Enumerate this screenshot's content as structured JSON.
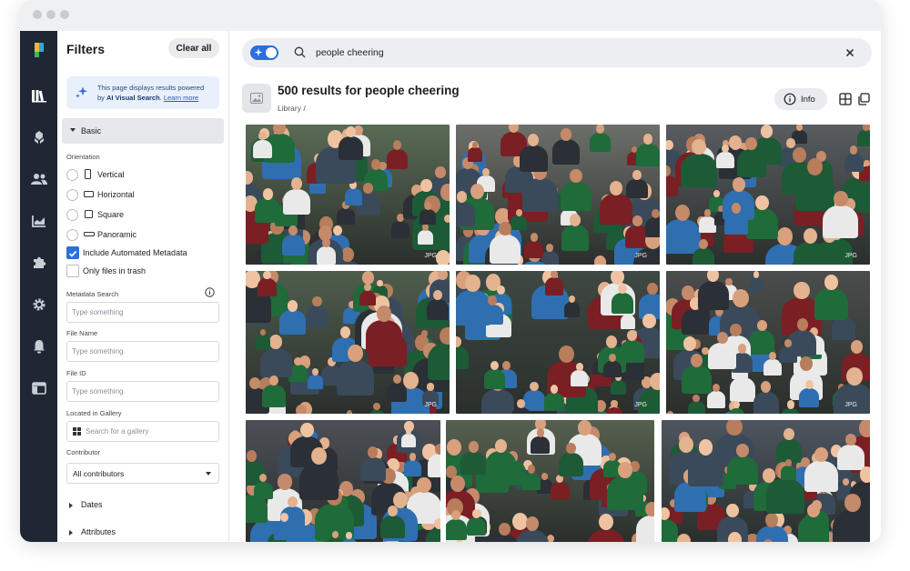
{
  "filters": {
    "title": "Filters",
    "clear_all": "Clear all",
    "ai_note": {
      "line1": "This page displays results powered",
      "by": "by ",
      "brand": "AI Visual Search",
      "learn_more": "Learn more"
    },
    "basic": "Basic",
    "orientation_label": "Orientation",
    "orientations": [
      "Vertical",
      "Horizontal",
      "Square",
      "Panoramic"
    ],
    "include_automated_metadata": "Include Automated Metadata",
    "include_automated_metadata_checked": true,
    "only_trash": "Only files in trash",
    "only_trash_checked": false,
    "metadata_search": {
      "label": "Metadata Search",
      "placeholder": "Type something"
    },
    "file_name": {
      "label": "File Name",
      "placeholder": "Type something"
    },
    "file_id": {
      "label": "File ID",
      "placeholder": "Type something"
    },
    "gallery": {
      "label": "Located in Gallery",
      "placeholder": "Search for a gallery"
    },
    "contributor": {
      "label": "Contributor",
      "value": "All contributors"
    },
    "dates": "Dates",
    "attributes": "Attributes"
  },
  "search": {
    "query": "people cheering"
  },
  "results": {
    "title": "500 results for people cheering",
    "breadcrumb": "Library /",
    "info_button": "Info"
  },
  "photos": [
    {
      "badge": "JPG",
      "tone": "#5a6b55"
    },
    {
      "badge": "JPG",
      "tone": "#6d6f6a"
    },
    {
      "badge": "JPG",
      "tone": "#595c60"
    },
    {
      "badge": "JPG",
      "tone": "#4f5d4d"
    },
    {
      "badge": "JPG",
      "tone": "#3f4842"
    },
    {
      "badge": "JPG",
      "tone": "#4a4d4b"
    },
    {
      "badge": "",
      "tone": "#4c4f56"
    },
    {
      "badge": "",
      "tone": "#56604f"
    },
    {
      "badge": "",
      "tone": "#4d5660"
    }
  ],
  "colors": {
    "accent": "#2a6fdc",
    "rail": "#1e2733",
    "pitch_green": "#2f6b3c"
  }
}
